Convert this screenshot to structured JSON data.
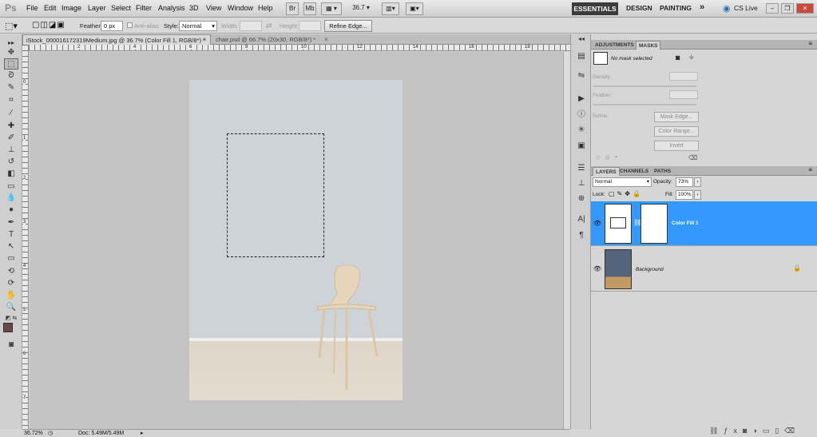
{
  "app": {
    "logo": "Ps"
  },
  "menu": {
    "items": [
      "File",
      "Edit",
      "Image",
      "Layer",
      "Select",
      "Filter",
      "Analysis",
      "3D",
      "View",
      "Window",
      "Help"
    ],
    "zoom": "36.7",
    "workspaces": [
      "ESSENTIALS",
      "DESIGN",
      "PAINTING"
    ],
    "more": "»",
    "cslive": "CS Live"
  },
  "options": {
    "feather_label": "Feather:",
    "feather_value": "0 px",
    "antialias_label": "Anti-alias",
    "style_label": "Style:",
    "style_value": "Normal",
    "width_label": "Width:",
    "height_label": "Height:",
    "refine_edge": "Refine Edge..."
  },
  "tabs": [
    {
      "label": "iStock_000016172319Medium.jpg @ 36.7% (Color Fill 1, RGB/8*) *",
      "close": "×"
    },
    {
      "label": "chair.psd @ 66.7% (20x30, RGB/8*) *",
      "close": "×"
    }
  ],
  "ruler": {
    "top": [
      "2",
      "4",
      "6",
      "8",
      "10",
      "12",
      "14",
      "16",
      "18"
    ],
    "left": [
      "0",
      "1",
      "2",
      "3",
      "4",
      "5",
      "6",
      "7",
      "8"
    ]
  },
  "status": {
    "zoom": "36.72%",
    "doc": "Doc: 5.49M/5.49M"
  },
  "adjust_panel": {
    "tabs": [
      "ADJUSTMENTS",
      "MASKS"
    ],
    "mask_status": "No mask selected",
    "density_label": "Density:",
    "feather_label": "Feather:",
    "refine_label": "Refine:",
    "buttons": [
      "Mask Edge...",
      "Color Range...",
      "Invert"
    ]
  },
  "layers_panel": {
    "tabs": [
      "LAYERS",
      "CHANNELS",
      "PATHS"
    ],
    "blend_mode": "Normal",
    "opacity_label": "Opacity:",
    "opacity_value": "73%",
    "lock_label": "Lock:",
    "fill_label": "Fill:",
    "fill_value": "100%",
    "layers": [
      {
        "name": "Color Fill 1",
        "selected": true
      },
      {
        "name": "Background",
        "selected": false
      }
    ]
  },
  "colors": {
    "selection": "#3399ff",
    "fg_color": "#6a4a40",
    "canvas_bg": "#c3c3c3"
  }
}
